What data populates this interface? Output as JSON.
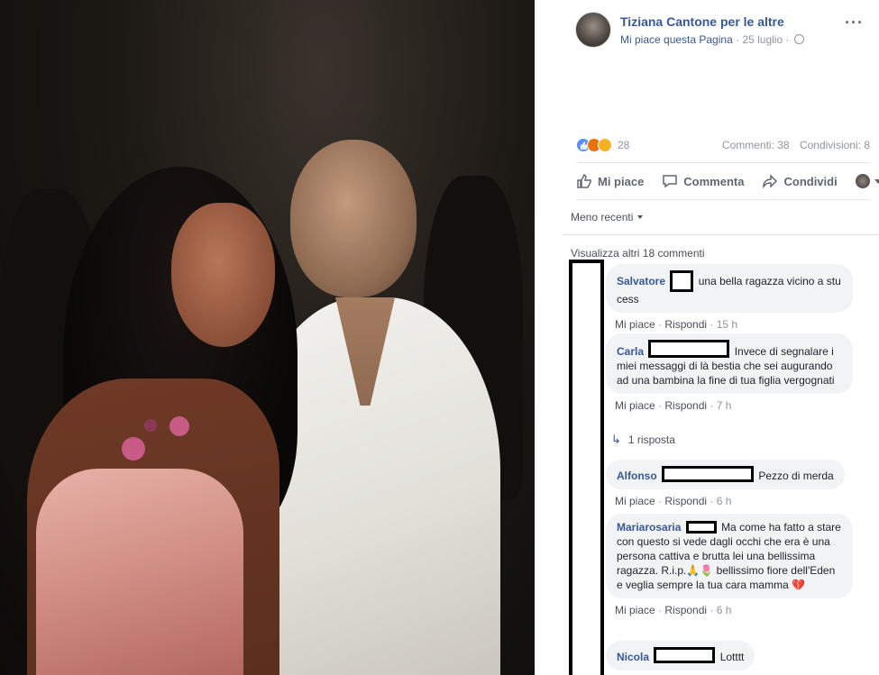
{
  "post": {
    "page_name": "Tiziana Cantone per le altre",
    "like_page": "Mi piace questa Pagina",
    "date": "25 luglio",
    "separator": "·",
    "more": "···"
  },
  "stats": {
    "reaction_count": "28",
    "comments": "Commenti: 38",
    "shares": "Condivisioni: 8"
  },
  "actions": {
    "like": "Mi piace",
    "comment": "Commenta",
    "share": "Condividi"
  },
  "sort_label": "Meno recenti",
  "view_more": "Visualizza altri 18 commenti",
  "comments": [
    {
      "author": "Salvatore",
      "text": "una bella ragazza vicino a stu cess",
      "like": "Mi piace",
      "reply": "Rispondi",
      "time": "15 h"
    },
    {
      "author": "Carla",
      "text": "Invece di segnalare i miei messaggi di là bestia che sei augurando ad una bambina la fine di tua figlia vergognati",
      "like": "Mi piace",
      "reply": "Rispondi",
      "time": "7 h"
    },
    {
      "author": "Alfonso",
      "text": "Pezzo di merda",
      "like": "Mi piace",
      "reply": "Rispondi",
      "time": "6 h"
    },
    {
      "author": "Mariarosaria",
      "text": "Ma come ha fatto a stare con questo si vede dagli occhi che era è una persona cattiva e brutta lei una bellissima ragazza. R.i.p.🙏🌷 bellissimo fiore dell'Eden e veglia sempre la tua cara mamma 💔",
      "like": "Mi piace",
      "reply": "Rispondi",
      "time": "6 h"
    },
    {
      "author": "Nicola",
      "text": "Lotttt"
    }
  ],
  "reply_count": "1 risposta",
  "colors": {
    "link": "#365899",
    "muted": "#90949c",
    "bubble": "#f2f3f5"
  },
  "icons": [
    "globe-icon",
    "more-icon",
    "like-icon",
    "comment-icon",
    "share-icon",
    "reply-arrow-icon"
  ]
}
